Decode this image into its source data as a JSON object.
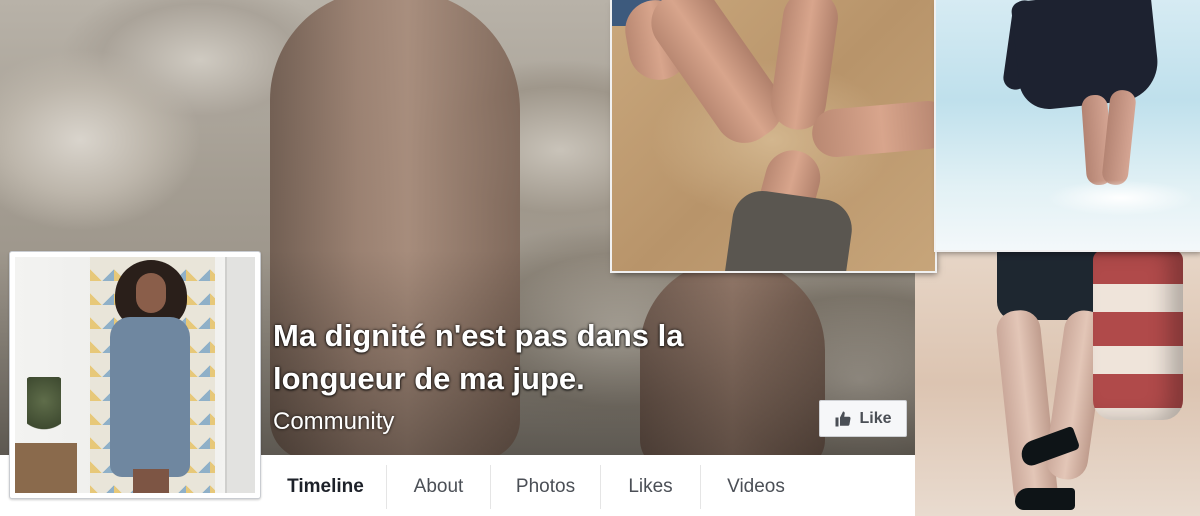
{
  "page": {
    "title": "Ma dignité n'est pas dans la longueur de ma jupe.",
    "category": "Community"
  },
  "actions": {
    "like_label": "Like",
    "like_icon": "thumbs-up-icon"
  },
  "tabs": [
    {
      "label": "Timeline",
      "active": true
    },
    {
      "label": "About",
      "active": false
    },
    {
      "label": "Photos",
      "active": false
    },
    {
      "label": "Likes",
      "active": false
    },
    {
      "label": "Videos",
      "active": false
    }
  ],
  "colors": {
    "title_text": "#ffffff",
    "like_button_bg": "#f6f7f9",
    "tab_text": "#4b4f56",
    "tab_active_text": "#1d2129"
  }
}
